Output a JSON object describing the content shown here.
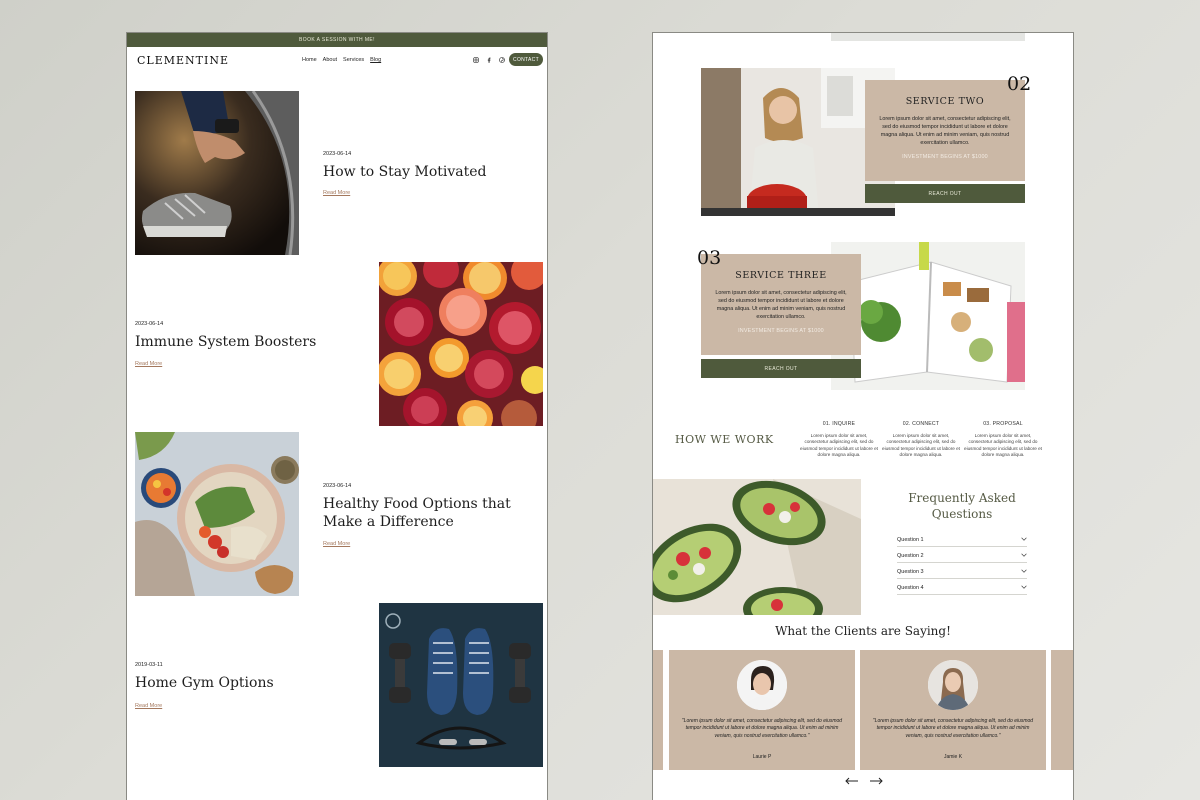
{
  "left": {
    "banner": "BOOK A SESSION WITH ME!",
    "brand": "CLEMENTINE",
    "nav": [
      "Home",
      "About",
      "Services",
      "Blog"
    ],
    "nav_active": "Blog",
    "contact_label": "CONTACT",
    "posts": [
      {
        "date": "2023-06-14",
        "title": "How to Stay Motivated",
        "read_more": "Read More"
      },
      {
        "date": "2023-06-14",
        "title": "Immune System Boosters",
        "read_more": "Read More"
      },
      {
        "date": "2023-06-14",
        "title": "Healthy Food Options that Make a Difference",
        "read_more": "Read More"
      },
      {
        "date": "2019-03-11",
        "title": "Home Gym Options",
        "read_more": "Read More"
      }
    ]
  },
  "right": {
    "services": [
      {
        "number": "02",
        "title": "SERVICE TWO",
        "desc": "Lorem ipsum dolor sit amet, consectetur adipiscing elit, sed do eiusmod tempor incididunt ut labore et dolore magna aliqua. Ut enim ad minim veniam, quis nostrud exercitation ullamco.",
        "invest": "INVESTMENT BEGINS AT $1000",
        "button": "REACH OUT"
      },
      {
        "number": "03",
        "title": "SERVICE THREE",
        "desc": "Lorem ipsum dolor sit amet, consectetur adipiscing elit, sed do eiusmod tempor incididunt ut labore et dolore magna aliqua. Ut enim ad minim veniam, quis nostrud exercitation ullamco.",
        "invest": "INVESTMENT BEGINS AT $1000",
        "button": "REACH OUT"
      }
    ],
    "how_we_work": {
      "title": "HOW WE WORK",
      "steps": [
        {
          "title": "01. INQUIRE",
          "desc": "Lorem ipsum dolor sit amet, consectetur adipiscing elit, sed do eiusmod tempor incididunt ut labore et dolore magna aliqua."
        },
        {
          "title": "02. CONNECT",
          "desc": "Lorem ipsum dolor sit amet, consectetur adipiscing elit, sed do eiusmod tempor incididunt ut labore et dolore magna aliqua."
        },
        {
          "title": "03. PROPOSAL",
          "desc": "Lorem ipsum dolor sit amet, consectetur adipiscing elit, sed do eiusmod tempor incididunt ut labore et dolore magna aliqua."
        }
      ]
    },
    "faq": {
      "title_line1": "Frequently Asked",
      "title_line2": "Questions",
      "items": [
        "Question 1",
        "Question 2",
        "Question 3",
        "Question 4"
      ]
    },
    "clients_title": "What the Clients are Saying!",
    "testimonials": [
      {
        "quote": "\"Lorem ipsum dolor sit amet, consectetur adipiscing elit, sed do eiusmod tempor incididunt ut labore et dolore magna aliqua. Ut enim ad minim veniam, quis nostrud exercitation ullamco.\"",
        "author": "Laurie P"
      },
      {
        "quote": "\"Lorem ipsum dolor sit amet, consectetur adipiscing elit, sed do eiusmod tempor incididunt ut labore et dolore magna aliqua. Ut enim ad minim veniam, quis nostrud exercitation ullamco.\"",
        "author": "Jamie K"
      }
    ]
  },
  "colors": {
    "accent_green": "#4f5a3c",
    "card_tan": "#cbb8a6",
    "link_brown": "#a4785d"
  },
  "icons": [
    "instagram-icon",
    "facebook-icon",
    "pinterest-icon",
    "chevron-down-icon",
    "arrow-left-icon",
    "arrow-right-icon"
  ]
}
